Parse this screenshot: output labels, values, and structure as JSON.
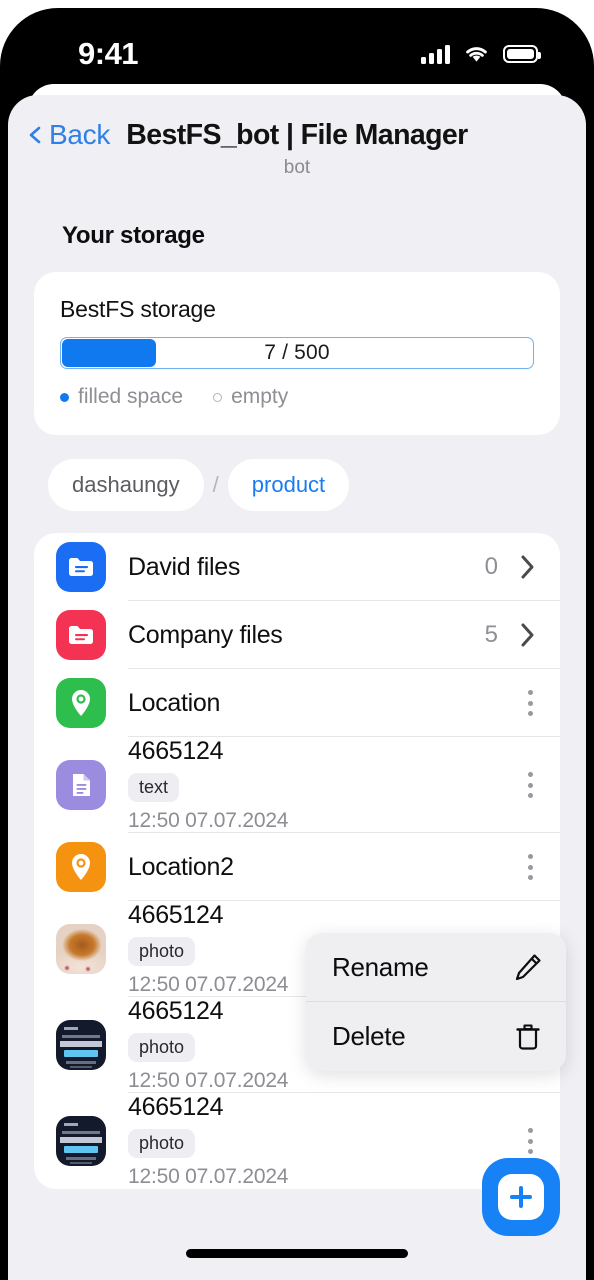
{
  "status_bar": {
    "time": "9:41",
    "signal_icon": "cellular-signal-icon",
    "wifi_icon": "wifi-icon",
    "battery_icon": "battery-icon"
  },
  "header": {
    "back_label": "Back",
    "back_icon": "chevron-left-icon",
    "title": "BestFS_bot | File Manager",
    "subtitle": "bot"
  },
  "storage": {
    "section_heading": "Your storage",
    "card_title": "BestFS storage",
    "progress_value_label": "7 / 500",
    "used": 7,
    "total": 500,
    "fill_percent": 20,
    "fill_color": "#1179ef",
    "track_border_color": "#6fb2ef",
    "legend": [
      {
        "label": "filled space",
        "style": "filled"
      },
      {
        "label": "empty",
        "style": "empty"
      }
    ]
  },
  "breadcrumb": {
    "separator": "/",
    "items": [
      {
        "label": "dashaungy",
        "active": false
      },
      {
        "label": "product",
        "active": true
      }
    ]
  },
  "files": [
    {
      "name": "David files",
      "icon": "folder-icon",
      "icon_color": "#1b6ef3",
      "count": "0",
      "action": "chevron",
      "layout": "simple"
    },
    {
      "name": "Company files",
      "icon": "folder-icon",
      "icon_color": "#f43254",
      "count": "5",
      "action": "chevron",
      "layout": "simple"
    },
    {
      "name": "Location",
      "icon": "location-pin-icon",
      "icon_color": "#2dbe4e",
      "count": "",
      "action": "kebab",
      "layout": "simple"
    },
    {
      "name": "4665124",
      "icon": "document-icon",
      "icon_color": "#9b8ce0",
      "tag": "text",
      "date": "12:50 07.07.2024",
      "action": "kebab",
      "layout": "detail"
    },
    {
      "name": "Location2",
      "icon": "location-pin-icon",
      "icon_color": "#f59311",
      "count": "",
      "action": "kebab",
      "layout": "simple"
    },
    {
      "name": "4665124",
      "icon": "photo-thumbnail-food",
      "icon_color": "",
      "tag": "photo",
      "date": "12:50 07.07.2024",
      "action": "kebab",
      "layout": "detail"
    },
    {
      "name": "4665124",
      "icon": "photo-thumbnail-screenshot",
      "icon_color": "",
      "tag": "photo",
      "date": "12:50 07.07.2024",
      "action": "kebab",
      "layout": "detail"
    },
    {
      "name": "4665124",
      "icon": "photo-thumbnail-screenshot",
      "icon_color": "",
      "tag": "photo",
      "date": "12:50 07.07.2024",
      "action": "kebab",
      "layout": "detail"
    }
  ],
  "context_menu": {
    "items": [
      {
        "label": "Rename",
        "icon": "pencil-icon"
      },
      {
        "label": "Delete",
        "icon": "trash-icon"
      }
    ]
  },
  "fab": {
    "icon": "plus-icon",
    "color": "#1782f5"
  }
}
